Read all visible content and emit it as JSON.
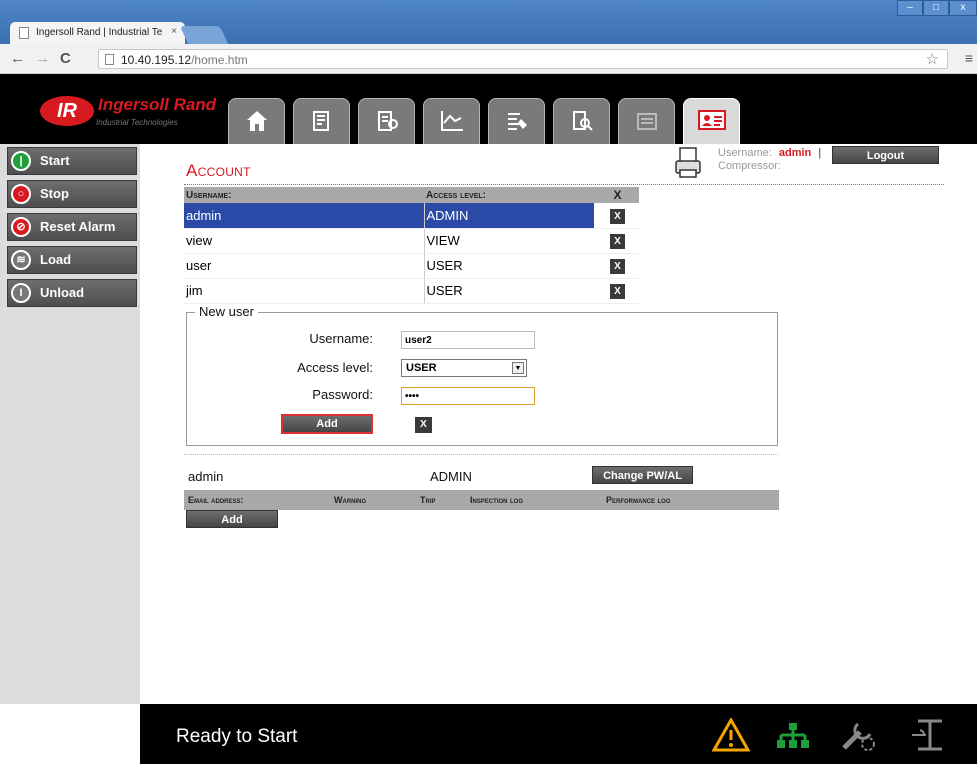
{
  "browser": {
    "tab_title": "Ingersoll Rand | Industrial Te",
    "tab_close": "×",
    "url_host": "10.40.195.12",
    "url_path": "/home.htm",
    "window_minimize": "–",
    "window_maximize": "□",
    "window_close": "x"
  },
  "header": {
    "logo_mark": "IR",
    "logo_text": "Ingersoll Rand",
    "logo_sub": "Industrial Technologies",
    "nav_tabs": [
      "home-icon",
      "report-icon",
      "settings-doc-icon",
      "chart-icon",
      "config-icon",
      "search-log-icon",
      "calendar-icon",
      "user-card-icon"
    ]
  },
  "sidebar": {
    "items": [
      {
        "label": "Start",
        "icon": "start-icon",
        "color": "#1f9e3a"
      },
      {
        "label": "Stop",
        "icon": "stop-icon",
        "color": "#d71920"
      },
      {
        "label": "Reset Alarm",
        "icon": "reset-alarm-icon",
        "color": "#d71920"
      },
      {
        "label": "Load",
        "icon": "load-icon",
        "color": "#777777"
      },
      {
        "label": "Unload",
        "icon": "unload-icon",
        "color": "#777777"
      }
    ]
  },
  "main": {
    "title": "Account",
    "username_label": "Username:",
    "username_value": "admin",
    "username_sep": "|",
    "compressor_label": "Compressor:",
    "logout_label": "Logout",
    "table": {
      "headers": [
        "Username:",
        "Access level:",
        "X"
      ],
      "rows": [
        {
          "username": "admin",
          "level": "ADMIN",
          "delete": "X",
          "selected": true
        },
        {
          "username": "view",
          "level": "VIEW",
          "delete": "X",
          "selected": false
        },
        {
          "username": "user",
          "level": "USER",
          "delete": "X",
          "selected": false
        },
        {
          "username": "jim",
          "level": "USER",
          "delete": "X",
          "selected": false
        }
      ]
    },
    "new_user": {
      "legend": "New user",
      "username_label": "Username:",
      "username_value": "user2",
      "level_label": "Access level:",
      "level_value": "USER",
      "password_label": "Password:",
      "password_value": "••••",
      "add_label": "Add",
      "clear_label": "X"
    },
    "current": {
      "username": "admin",
      "level": "ADMIN",
      "change_label": "Change PW/AL"
    },
    "email": {
      "headers": [
        "Email address:",
        "Warning",
        "Trip",
        "Inspection log",
        "Performance log"
      ],
      "add_label": "Add"
    }
  },
  "footer": {
    "status": "Ready to Start",
    "icons": [
      "warning-icon",
      "network-icon",
      "service-icon",
      "unload-valve-icon"
    ],
    "warning_color": "#f5a500",
    "network_color": "#1f9e3a"
  }
}
